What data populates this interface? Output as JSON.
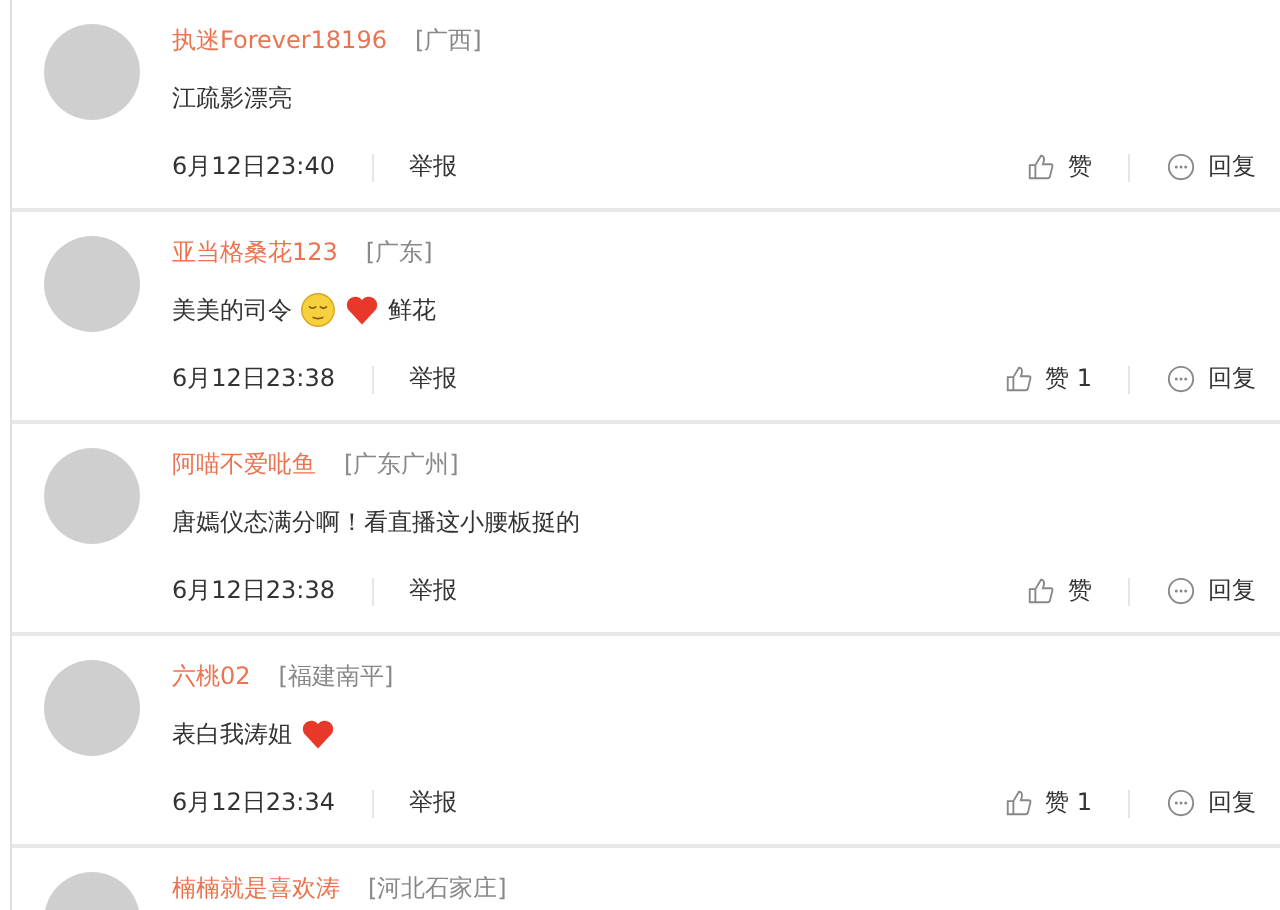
{
  "comments": [
    {
      "name": "执迷Forever18196",
      "location": "[广西]",
      "content": [
        {
          "kind": "text",
          "text": "江疏影漂亮"
        }
      ],
      "time": "6月12日23:40",
      "report": "举报",
      "like": "赞",
      "reply": "回复"
    },
    {
      "name": "亚当格桑花123",
      "location": "[广东]",
      "content": [
        {
          "kind": "text",
          "text": "美美的司令"
        },
        {
          "kind": "face"
        },
        {
          "kind": "heart"
        },
        {
          "kind": "text",
          "text": "鲜花"
        }
      ],
      "time": "6月12日23:38",
      "report": "举报",
      "like": "赞 1",
      "reply": "回复"
    },
    {
      "name": "阿喵不爱吡鱼",
      "location": "[广东广州]",
      "content": [
        {
          "kind": "text",
          "text": "唐嫣仪态满分啊！看直播这小腰板挺的"
        }
      ],
      "time": "6月12日23:38",
      "report": "举报",
      "like": "赞",
      "reply": "回复"
    },
    {
      "name": "六桃02",
      "location": "[福建南平]",
      "content": [
        {
          "kind": "text",
          "text": "表白我涛姐"
        },
        {
          "kind": "heart"
        }
      ],
      "time": "6月12日23:34",
      "report": "举报",
      "like": "赞 1",
      "reply": "回复"
    },
    {
      "name": "楠楠就是喜欢涛",
      "location": "[河北石家庄]"
    }
  ]
}
